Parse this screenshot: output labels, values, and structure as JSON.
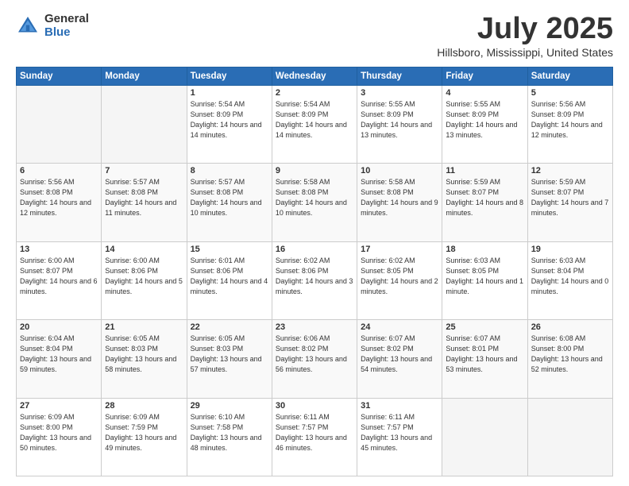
{
  "header": {
    "logo_general": "General",
    "logo_blue": "Blue",
    "month_title": "July 2025",
    "location": "Hillsboro, Mississippi, United States"
  },
  "days_of_week": [
    "Sunday",
    "Monday",
    "Tuesday",
    "Wednesday",
    "Thursday",
    "Friday",
    "Saturday"
  ],
  "weeks": [
    [
      {
        "day": "",
        "info": ""
      },
      {
        "day": "",
        "info": ""
      },
      {
        "day": "1",
        "info": "Sunrise: 5:54 AM\nSunset: 8:09 PM\nDaylight: 14 hours\nand 14 minutes."
      },
      {
        "day": "2",
        "info": "Sunrise: 5:54 AM\nSunset: 8:09 PM\nDaylight: 14 hours\nand 14 minutes."
      },
      {
        "day": "3",
        "info": "Sunrise: 5:55 AM\nSunset: 8:09 PM\nDaylight: 14 hours\nand 13 minutes."
      },
      {
        "day": "4",
        "info": "Sunrise: 5:55 AM\nSunset: 8:09 PM\nDaylight: 14 hours\nand 13 minutes."
      },
      {
        "day": "5",
        "info": "Sunrise: 5:56 AM\nSunset: 8:09 PM\nDaylight: 14 hours\nand 12 minutes."
      }
    ],
    [
      {
        "day": "6",
        "info": "Sunrise: 5:56 AM\nSunset: 8:08 PM\nDaylight: 14 hours\nand 12 minutes."
      },
      {
        "day": "7",
        "info": "Sunrise: 5:57 AM\nSunset: 8:08 PM\nDaylight: 14 hours\nand 11 minutes."
      },
      {
        "day": "8",
        "info": "Sunrise: 5:57 AM\nSunset: 8:08 PM\nDaylight: 14 hours\nand 10 minutes."
      },
      {
        "day": "9",
        "info": "Sunrise: 5:58 AM\nSunset: 8:08 PM\nDaylight: 14 hours\nand 10 minutes."
      },
      {
        "day": "10",
        "info": "Sunrise: 5:58 AM\nSunset: 8:08 PM\nDaylight: 14 hours\nand 9 minutes."
      },
      {
        "day": "11",
        "info": "Sunrise: 5:59 AM\nSunset: 8:07 PM\nDaylight: 14 hours\nand 8 minutes."
      },
      {
        "day": "12",
        "info": "Sunrise: 5:59 AM\nSunset: 8:07 PM\nDaylight: 14 hours\nand 7 minutes."
      }
    ],
    [
      {
        "day": "13",
        "info": "Sunrise: 6:00 AM\nSunset: 8:07 PM\nDaylight: 14 hours\nand 6 minutes."
      },
      {
        "day": "14",
        "info": "Sunrise: 6:00 AM\nSunset: 8:06 PM\nDaylight: 14 hours\nand 5 minutes."
      },
      {
        "day": "15",
        "info": "Sunrise: 6:01 AM\nSunset: 8:06 PM\nDaylight: 14 hours\nand 4 minutes."
      },
      {
        "day": "16",
        "info": "Sunrise: 6:02 AM\nSunset: 8:06 PM\nDaylight: 14 hours\nand 3 minutes."
      },
      {
        "day": "17",
        "info": "Sunrise: 6:02 AM\nSunset: 8:05 PM\nDaylight: 14 hours\nand 2 minutes."
      },
      {
        "day": "18",
        "info": "Sunrise: 6:03 AM\nSunset: 8:05 PM\nDaylight: 14 hours\nand 1 minute."
      },
      {
        "day": "19",
        "info": "Sunrise: 6:03 AM\nSunset: 8:04 PM\nDaylight: 14 hours\nand 0 minutes."
      }
    ],
    [
      {
        "day": "20",
        "info": "Sunrise: 6:04 AM\nSunset: 8:04 PM\nDaylight: 13 hours\nand 59 minutes."
      },
      {
        "day": "21",
        "info": "Sunrise: 6:05 AM\nSunset: 8:03 PM\nDaylight: 13 hours\nand 58 minutes."
      },
      {
        "day": "22",
        "info": "Sunrise: 6:05 AM\nSunset: 8:03 PM\nDaylight: 13 hours\nand 57 minutes."
      },
      {
        "day": "23",
        "info": "Sunrise: 6:06 AM\nSunset: 8:02 PM\nDaylight: 13 hours\nand 56 minutes."
      },
      {
        "day": "24",
        "info": "Sunrise: 6:07 AM\nSunset: 8:02 PM\nDaylight: 13 hours\nand 54 minutes."
      },
      {
        "day": "25",
        "info": "Sunrise: 6:07 AM\nSunset: 8:01 PM\nDaylight: 13 hours\nand 53 minutes."
      },
      {
        "day": "26",
        "info": "Sunrise: 6:08 AM\nSunset: 8:00 PM\nDaylight: 13 hours\nand 52 minutes."
      }
    ],
    [
      {
        "day": "27",
        "info": "Sunrise: 6:09 AM\nSunset: 8:00 PM\nDaylight: 13 hours\nand 50 minutes."
      },
      {
        "day": "28",
        "info": "Sunrise: 6:09 AM\nSunset: 7:59 PM\nDaylight: 13 hours\nand 49 minutes."
      },
      {
        "day": "29",
        "info": "Sunrise: 6:10 AM\nSunset: 7:58 PM\nDaylight: 13 hours\nand 48 minutes."
      },
      {
        "day": "30",
        "info": "Sunrise: 6:11 AM\nSunset: 7:57 PM\nDaylight: 13 hours\nand 46 minutes."
      },
      {
        "day": "31",
        "info": "Sunrise: 6:11 AM\nSunset: 7:57 PM\nDaylight: 13 hours\nand 45 minutes."
      },
      {
        "day": "",
        "info": ""
      },
      {
        "day": "",
        "info": ""
      }
    ]
  ]
}
